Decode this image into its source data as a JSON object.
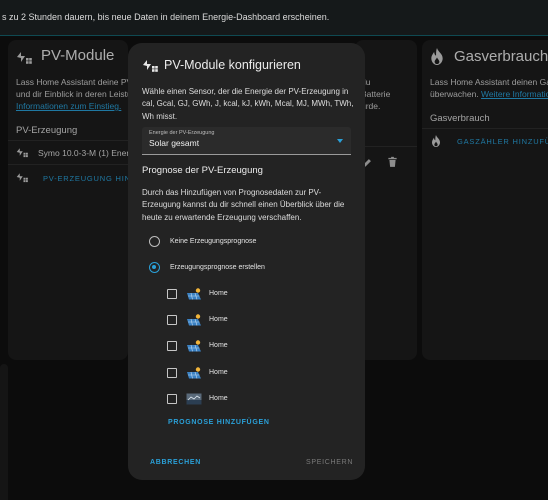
{
  "banner": {
    "text": "s zu 2 Stunden dauern, bis neue Daten in deinem Energie-Dashboard erscheinen."
  },
  "pv_card": {
    "title": "PV-Module",
    "desc_line1": "Lass Home Assistant deine PV-M",
    "desc_line2": "und dir Einblick in deren Leistung",
    "desc_link": "Informationen zum Einstieg.",
    "section_label": "PV-Erzeugung",
    "source_row": "Symo 10.0-3-M (1) Energie",
    "add_button": "PV-ERZEUGUNG HINZUF"
  },
  "battery_card": {
    "desc_line1": "du",
    "desc_line2": "Batterie",
    "desc_line3": "urde."
  },
  "gas_card": {
    "title": "Gasverbrauch",
    "desc_line1": "Lass Home Assistant deinen Gasv",
    "desc_line2": "überwachen. ",
    "desc_link": "Weitere Informationen",
    "section_label": "Gasverbrauch",
    "add_button": "GASZÄHLER HINZUFÜGEN"
  },
  "dialog": {
    "title": "PV-Module konfigurieren",
    "intro": "Wähle einen Sensor, der die Energie der PV-Erzeugung in cal, Gcal, GJ, GWh, J, kcal, kJ, kWh, Mcal, MJ, MWh, TWh, Wh misst.",
    "select": {
      "label": "Energie der PV-Erzeugung",
      "value": "Solar gesamt"
    },
    "forecast_title": "Prognose der PV-Erzeugung",
    "forecast_desc": "Durch das Hinzufügen von Prognosedaten zur PV-Erzeugung kannst du dir schnell einen Überblick über die heute zu erwartende Erzeugung verschaffen.",
    "radio_options": [
      {
        "label": "Keine Erzeugungsprognose",
        "selected": false
      },
      {
        "label": "Erzeugungsprognose erstellen",
        "selected": true
      }
    ],
    "forecasts": [
      {
        "label": "Home",
        "checked": false,
        "icon": "solar-panel-icon"
      },
      {
        "label": "Home",
        "checked": false,
        "icon": "solar-panel-icon"
      },
      {
        "label": "Home",
        "checked": false,
        "icon": "solar-panel-icon"
      },
      {
        "label": "Home",
        "checked": false,
        "icon": "solar-panel-icon"
      },
      {
        "label": "Home",
        "checked": false,
        "icon": "forecast-integration-icon"
      }
    ],
    "add_forecast": "PROGNOSE HINZUFÜGEN",
    "cancel": "ABBRECHEN",
    "save": "SPEICHERN"
  },
  "colors": {
    "accent": "#2aa0d8",
    "card": "#1c1c1c",
    "dialog": "#232323",
    "background": "#111111"
  }
}
